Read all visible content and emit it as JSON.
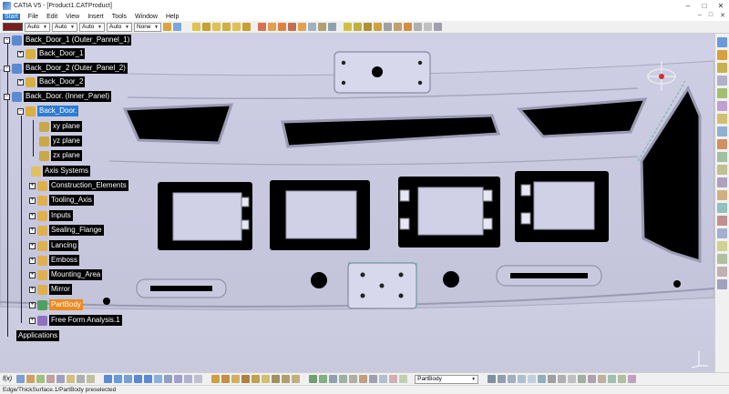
{
  "window": {
    "title": "CATIA V5 - [Product1.CATProduct]",
    "controls": [
      "–",
      "□",
      "✕"
    ]
  },
  "menu": {
    "items": [
      "Start",
      "File",
      "Edit",
      "View",
      "Insert",
      "Tools",
      "Window",
      "Help"
    ],
    "mdi_controls": [
      "–",
      "□",
      "✕"
    ]
  },
  "properties_toolbar": {
    "color": "#7a1f1f",
    "transparency": "Auto",
    "line_thickness": "Auto",
    "line_type": "Auto",
    "point_symbol": "Auto",
    "layer": "None"
  },
  "tree": {
    "nodes": [
      {
        "id": "back-door-1-outer",
        "label": "Back_Door_1 (Outer_Pannel_1)",
        "style": "normal"
      },
      {
        "id": "back-door-1",
        "label": "Back_Door_1",
        "style": "normal"
      },
      {
        "id": "back-door-2-outer",
        "label": "Back_Door_2 (Outer_Panel_2)",
        "style": "normal"
      },
      {
        "id": "back-door-2",
        "label": "Back_Door_2",
        "style": "normal"
      },
      {
        "id": "back-door-inner",
        "label": "Back_Door. (Inner_Panel)",
        "style": "normal"
      },
      {
        "id": "back-door",
        "label": "Back_Door.",
        "style": "selected"
      },
      {
        "id": "xy-plane",
        "label": "xy plane",
        "style": "normal"
      },
      {
        "id": "yz-plane",
        "label": "yz plane",
        "style": "normal"
      },
      {
        "id": "zx-plane",
        "label": "zx plane",
        "style": "normal"
      },
      {
        "id": "axis-systems",
        "label": "Axis Systems",
        "style": "normal"
      },
      {
        "id": "construction-elements",
        "label": "Construction_Elements",
        "style": "normal"
      },
      {
        "id": "tooling-axis",
        "label": "Tooling_Axis",
        "style": "normal"
      },
      {
        "id": "inputs",
        "label": "Inputs",
        "style": "normal"
      },
      {
        "id": "sealing-flange",
        "label": "Sealing_Flange",
        "style": "normal"
      },
      {
        "id": "lancing",
        "label": "Lancing",
        "style": "normal"
      },
      {
        "id": "emboss",
        "label": "Emboss",
        "style": "normal"
      },
      {
        "id": "mounting-area",
        "label": "Mounting_Area",
        "style": "normal"
      },
      {
        "id": "mirror",
        "label": "Mirror",
        "style": "normal"
      },
      {
        "id": "partbody",
        "label": "PartBody",
        "style": "orange"
      },
      {
        "id": "free-form-analysis",
        "label": "Free Form Analysis.1",
        "style": "normal"
      },
      {
        "id": "applications",
        "label": "Applications",
        "style": "normal"
      }
    ]
  },
  "bottom_toolbar": {
    "fco_label": "f(x)",
    "body_selector": "PartBody"
  },
  "status": {
    "message": "Edge/ThickSurface.1/PartBody preselected"
  },
  "colors": {
    "viewport_bg": "#d2d2e8",
    "tree_label_bg": "#000000",
    "selection": "#2e7bd0",
    "current_body": "#f08a1c"
  }
}
